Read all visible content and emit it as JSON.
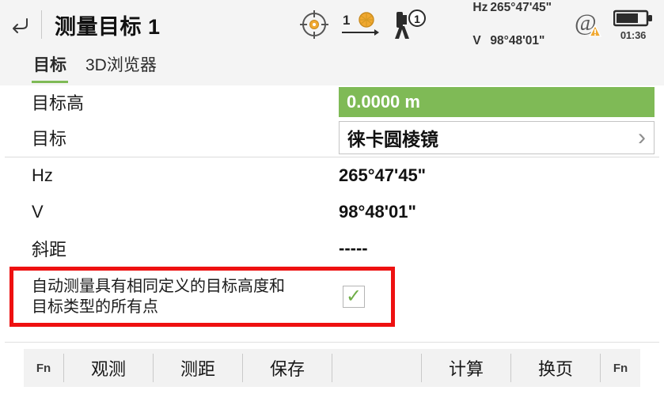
{
  "titlebar": {
    "back_icon": "back-arrow-icon",
    "title": "测量目标 1",
    "icons": {
      "target_lock": "target-crosshair-icon",
      "prism_count": "1",
      "prism_icon": "prism-arrow-icon",
      "instrument_icon": "total-station-icon",
      "instrument_face": "1",
      "connection_icon": "at-symbol-warning-icon",
      "battery_icon": "battery-icon"
    },
    "angles": {
      "hz_label": "Hz",
      "hz_value": "265°47'45\"",
      "v_label": "V",
      "v_value": "98°48'01\""
    },
    "battery_time": "01:36"
  },
  "tabs": [
    {
      "label": "目标",
      "active": true
    },
    {
      "label": "3D浏览器",
      "active": false
    }
  ],
  "form": {
    "rows": [
      {
        "label": "目标高",
        "value": "0.0000 m",
        "type": "green-field"
      },
      {
        "label": "目标",
        "value": "徕卡圆棱镜",
        "type": "select-field",
        "chevron": "chevron-right-icon"
      },
      {
        "label": "Hz",
        "value": "265°47'45\"",
        "type": "text"
      },
      {
        "label": "V",
        "value": "98°48'01\"",
        "type": "text"
      },
      {
        "label": "斜距",
        "value": "-----",
        "type": "text"
      }
    ]
  },
  "auto_measure": {
    "text": "自动测量具有相同定义的目标高度和目标类型的所有点",
    "checked": true,
    "check_icon": "checkmark-icon",
    "highlight_color": "#ee1111"
  },
  "toolbar": {
    "fn_left": "Fn",
    "fn_right": "Fn",
    "buttons": [
      {
        "label": "观测"
      },
      {
        "label": "测距"
      },
      {
        "label": "保存"
      },
      {
        "label": ""
      },
      {
        "label": "计算"
      },
      {
        "label": "换页"
      }
    ]
  },
  "colors": {
    "accent_green": "#7fba56",
    "highlight_red": "#ee1111",
    "bar_gray": "#f4f4f4",
    "orange": "#f0a830"
  }
}
